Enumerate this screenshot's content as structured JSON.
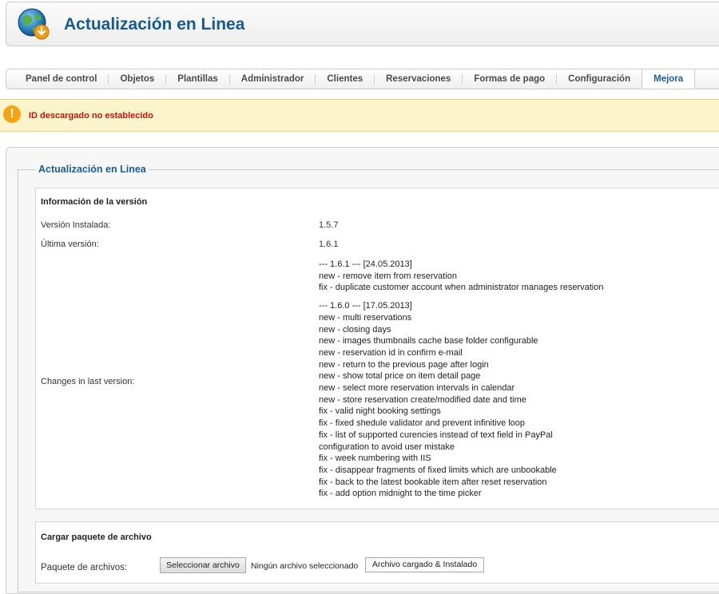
{
  "header": {
    "title": "Actualización en Linea",
    "icon": "globe-download-icon"
  },
  "tabs": [
    {
      "label": "Panel de control",
      "active": false
    },
    {
      "label": "Objetos",
      "active": false
    },
    {
      "label": "Plantillas",
      "active": false
    },
    {
      "label": "Administrador",
      "active": false
    },
    {
      "label": "Clientes",
      "active": false
    },
    {
      "label": "Reservaciones",
      "active": false
    },
    {
      "label": "Formas de pago",
      "active": false
    },
    {
      "label": "Configuración",
      "active": false
    },
    {
      "label": "Mejora",
      "active": true
    }
  ],
  "notice": {
    "text": "ID descargado no establecido",
    "icon": "warning-icon",
    "color": "#c3150f"
  },
  "section": {
    "legend": "Actualización en Linea"
  },
  "version_info": {
    "title": "Información de la versión",
    "installed_label": "Versión Instalada:",
    "installed_value": "1.5.7",
    "latest_label": "Última versión:",
    "latest_value": "1.6.1",
    "changes_label": "Changes in last version:",
    "changes": [
      {
        "header": "--- 1.6.1 --- [24.05.2013]",
        "items": [
          "new - remove item from reservation",
          "fix - duplicate customer account when administrator manages reservation"
        ]
      },
      {
        "header": "--- 1.6.0 --- [17.05.2013]",
        "items": [
          "new - multi reservations",
          "new - closing days",
          "new - images thumbnails cache base folder configurable",
          "new - reservation id in confirm e-mail",
          "new - return to the previous page after login",
          "new - show total price on item detail page",
          "new - select more reservation intervals in calendar",
          "new - store reservation create/modified date and time",
          "fix - valid night booking settings",
          "fix - fixed shedule validator and prevent infinitive loop",
          "fix - list of supported curencies instead of text field in PayPal",
          "configuration to avoid user mistake",
          "fix - week numbering with IIS",
          "fix - disappear fragments of fixed limits which are unbookable",
          "fix - back to the latest bookable item after reset reservation",
          "fix - add option midnight to the time picker"
        ]
      }
    ]
  },
  "upload": {
    "title": "Cargar paquete de archivo",
    "label": "Paquete de archivos:",
    "choose_button": "Seleccionar archivo",
    "file_status": "Ningún archivo seleccionado",
    "submit_button": "Archivo cargado & Instalado"
  },
  "colors": {
    "brand_blue": "#155b92",
    "notice_bg": "#fcf4cb",
    "warning_orange": "#f4a511"
  }
}
